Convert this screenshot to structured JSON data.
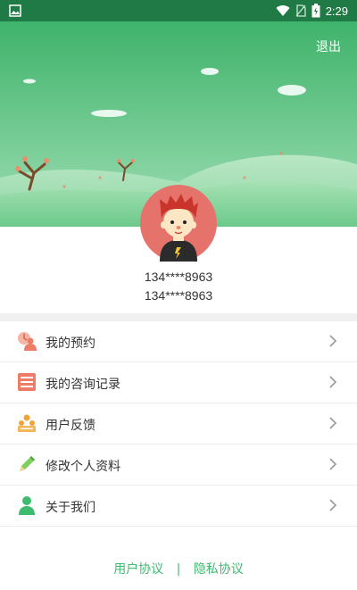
{
  "status_bar": {
    "time": "2:29"
  },
  "header": {
    "logout_label": "退出"
  },
  "profile": {
    "phone_line1": "134****8963",
    "phone_line2": "134****8963"
  },
  "menu": {
    "items": [
      {
        "label": "我的预约",
        "icon": "appointment-icon"
      },
      {
        "label": "我的咨询记录",
        "icon": "consultation-record-icon"
      },
      {
        "label": "用户反馈",
        "icon": "feedback-icon"
      },
      {
        "label": "修改个人资料",
        "icon": "edit-profile-icon"
      },
      {
        "label": "关于我们",
        "icon": "about-us-icon"
      }
    ]
  },
  "footer": {
    "user_agreement": "用户协议",
    "separator": "|",
    "privacy_policy": "隐私协议"
  },
  "colors": {
    "accent": "#3dbb6f",
    "header_top": "#3fb36b",
    "header_bottom": "#9fdeb4",
    "avatar_bg": "#e5736b"
  }
}
